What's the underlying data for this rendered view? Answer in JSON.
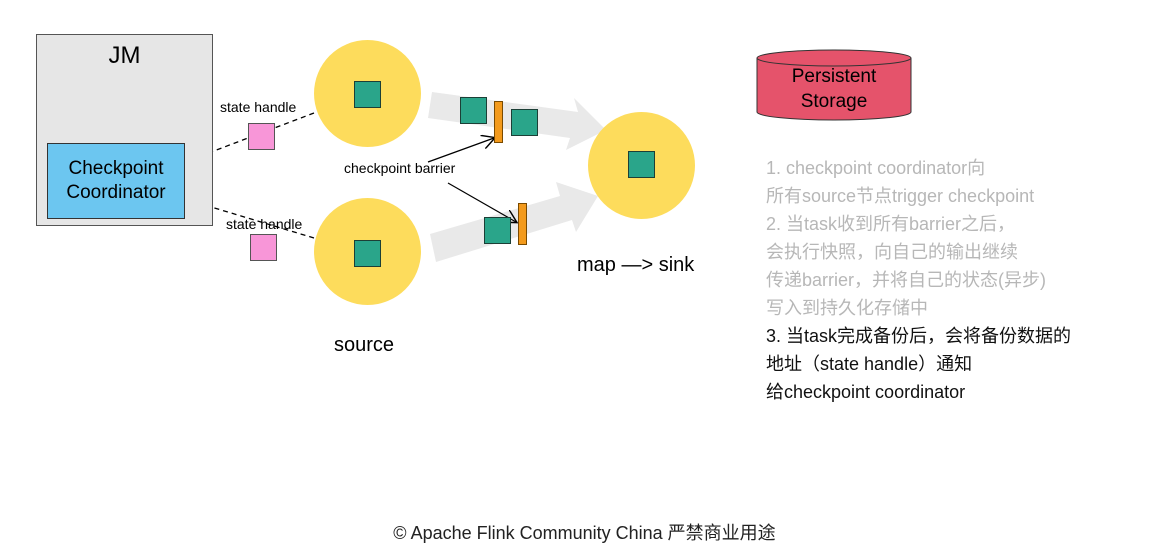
{
  "jm": {
    "title": "JM",
    "coordinator_label": "Checkpoint\nCoordinator"
  },
  "labels": {
    "state_handle_top": "state handle",
    "state_handle_bottom": "state handle",
    "checkpoint_barrier": "checkpoint barrier",
    "source": "source",
    "map_sink": "map —> sink"
  },
  "storage": {
    "label": "Persistent\nStorage"
  },
  "steps": [
    {
      "lines": [
        "1. checkpoint coordinator向",
        "所有source节点trigger checkpoint"
      ],
      "highlight": false
    },
    {
      "lines": [
        "2. 当task收到所有barrier之后，",
        "会执行快照，向自己的输出继续",
        "传递barrier，并将自己的状态(异步)",
        "写入到持久化存储中"
      ],
      "highlight": false
    },
    {
      "lines": [
        "3. 当task完成备份后，会将备份数据的",
        "地址（state handle）通知",
        "给checkpoint coordinator"
      ],
      "highlight": true
    }
  ],
  "footer": "© Apache Flink Community China  严禁商业用途",
  "colors": {
    "node": "#fddc5c",
    "record": "#2aa58a",
    "state_handle": "#f896d8",
    "barrier": "#f39a1c",
    "coordinator": "#6cc6f0",
    "jm": "#e6e6e6",
    "storage": "#e5536b",
    "flow_arrow": "#e9e9e9"
  }
}
